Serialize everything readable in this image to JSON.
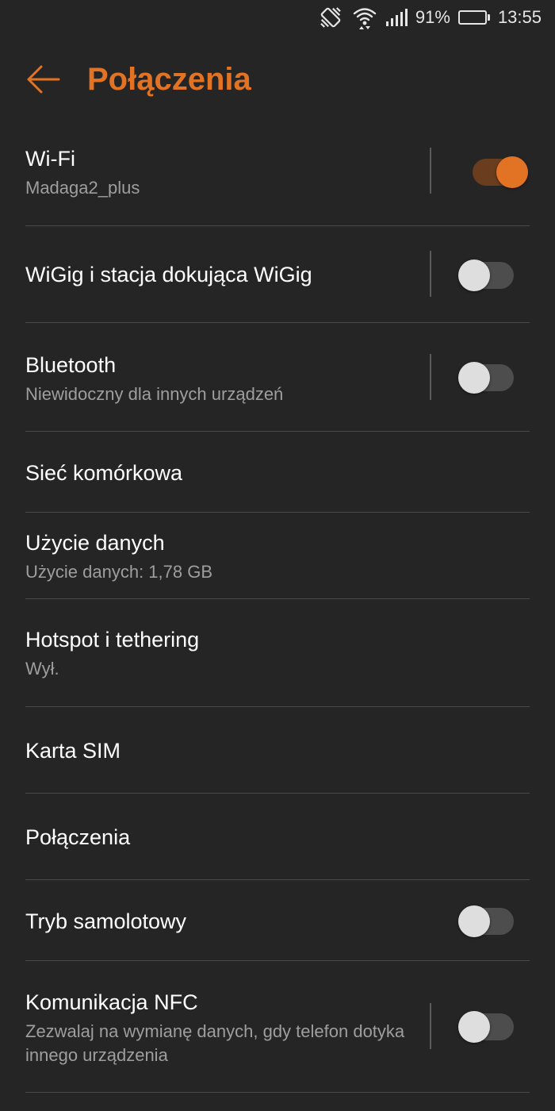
{
  "status_bar": {
    "battery": "91%",
    "battery_level": 0.91,
    "time": "13:55",
    "icons": [
      "vibrate-icon",
      "wifi-icon",
      "cell-signal-icon",
      "battery-icon"
    ]
  },
  "header": {
    "title": "Połączenia",
    "back_icon": "arrow-left-icon"
  },
  "colors": {
    "accent": "#e37324",
    "background": "#252525"
  },
  "settings": [
    {
      "title": "Wi-Fi",
      "subtitle": "Madaga2_plus",
      "toggle": true,
      "on": true
    },
    {
      "title": "WiGig i stacja dokująca WiGig",
      "subtitle": "",
      "toggle": true,
      "on": false
    },
    {
      "title": "Bluetooth",
      "subtitle": "Niewidoczny dla innych urządzeń",
      "toggle": true,
      "on": false
    },
    {
      "title": "Sieć komórkowa",
      "subtitle": ""
    },
    {
      "title": "Użycie danych",
      "subtitle": "Użycie danych: 1,78 GB"
    },
    {
      "title": "Hotspot i tethering",
      "subtitle": "Wył."
    },
    {
      "title": "Karta SIM",
      "subtitle": ""
    },
    {
      "title": "Połączenia",
      "subtitle": ""
    },
    {
      "title": "Tryb samolotowy",
      "subtitle": "",
      "toggle": true,
      "on": false
    },
    {
      "title": "Komunikacja NFC",
      "subtitle": "Zezwalaj na wymianę danych, gdy telefon dotyka innego urządzenia",
      "toggle": true,
      "on": false
    }
  ]
}
